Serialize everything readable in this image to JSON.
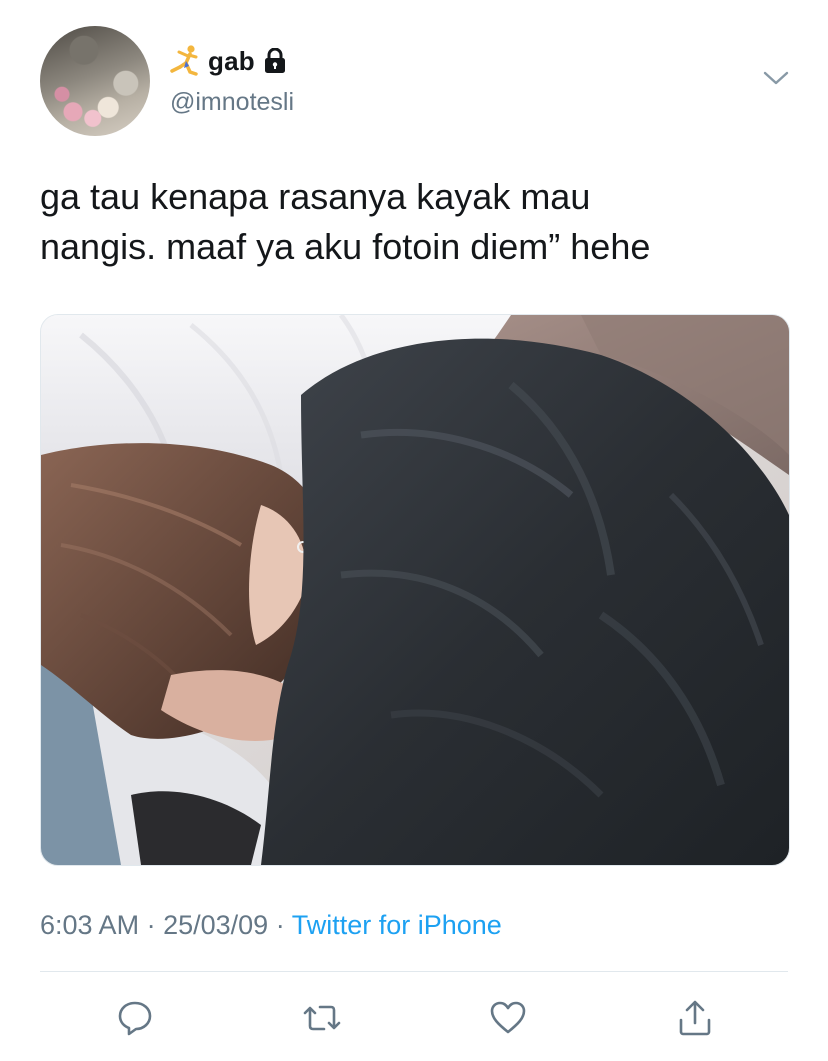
{
  "tweet": {
    "user": {
      "display_name": "gab",
      "handle": "@imnotesli",
      "protected": true,
      "name_prefix_icon": "person-dancing-icon"
    },
    "text_lines": [
      "ga tau kenapa rasanya kayak mau",
      "nangis. maaf ya aku fotoin diem” hehe"
    ],
    "time": "6:03 AM",
    "separator": "·",
    "date": "25/03/09",
    "source": "Twitter for iPhone"
  },
  "actions": [
    {
      "name": "reply",
      "icon": "reply-icon"
    },
    {
      "name": "retweet",
      "icon": "retweet-icon"
    },
    {
      "name": "like",
      "icon": "heart-icon"
    },
    {
      "name": "share",
      "icon": "share-icon"
    }
  ],
  "colors": {
    "text": "#14171a",
    "secondary": "#657786",
    "link": "#1da1f2",
    "divider": "#e1e8ed"
  }
}
